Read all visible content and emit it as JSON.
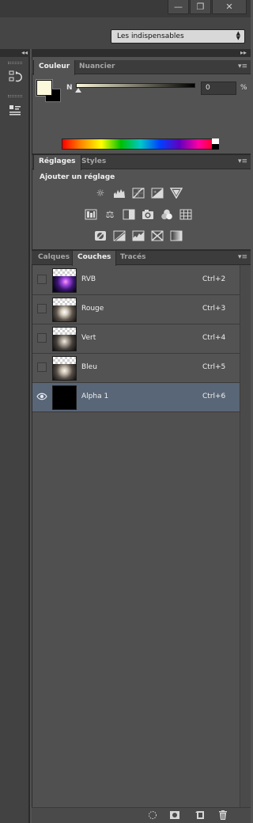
{
  "window_controls": {
    "minimize": "—",
    "restore": "❐",
    "close": "✕"
  },
  "workspace": {
    "selected": "Les indispensables"
  },
  "icons": {
    "history": "history-icon",
    "properties": "properties-icon",
    "panel_menu": "panel-menu-icon",
    "collapse": "collapse-arrows-icon",
    "visibility": "eye-icon"
  },
  "color_panel": {
    "tabs": [
      "Couleur",
      "Nuancier"
    ],
    "active_tab": "Couleur",
    "channel_label": "N",
    "value": "0",
    "unit": "%",
    "foreground_color": "#fcf8dc",
    "background_color": "#000000",
    "slider_position": 0
  },
  "adjustments_panel": {
    "tabs": [
      "Réglages",
      "Styles"
    ],
    "active_tab": "Réglages",
    "heading": "Ajouter un réglage",
    "row1": [
      "brightness-contrast-icon",
      "levels-icon",
      "curves-icon",
      "exposure-icon",
      "vibrance-icon"
    ],
    "row2": [
      "hue-saturation-icon",
      "color-balance-icon",
      "black-white-icon",
      "photo-filter-icon",
      "channel-mixer-icon",
      "color-lookup-icon"
    ],
    "row3": [
      "invert-icon",
      "posterize-icon",
      "threshold-icon",
      "selective-color-icon",
      "gradient-map-icon"
    ]
  },
  "channels_panel": {
    "tabs": [
      "Calques",
      "Couches",
      "Tracés"
    ],
    "active_tab": "Couches",
    "rows": [
      {
        "name": "RVB",
        "shortcut": "Ctrl+2",
        "visible": false,
        "selected": false
      },
      {
        "name": "Rouge",
        "shortcut": "Ctrl+3",
        "visible": false,
        "selected": false
      },
      {
        "name": "Vert",
        "shortcut": "Ctrl+4",
        "visible": false,
        "selected": false
      },
      {
        "name": "Bleu",
        "shortcut": "Ctrl+5",
        "visible": false,
        "selected": false
      },
      {
        "name": "Alpha 1",
        "shortcut": "Ctrl+6",
        "visible": true,
        "selected": true
      }
    ],
    "selected_row_color": "#596677"
  },
  "bottom_bar": [
    "load-selection-icon",
    "save-selection-icon",
    "new-channel-icon",
    "trash-icon"
  ]
}
